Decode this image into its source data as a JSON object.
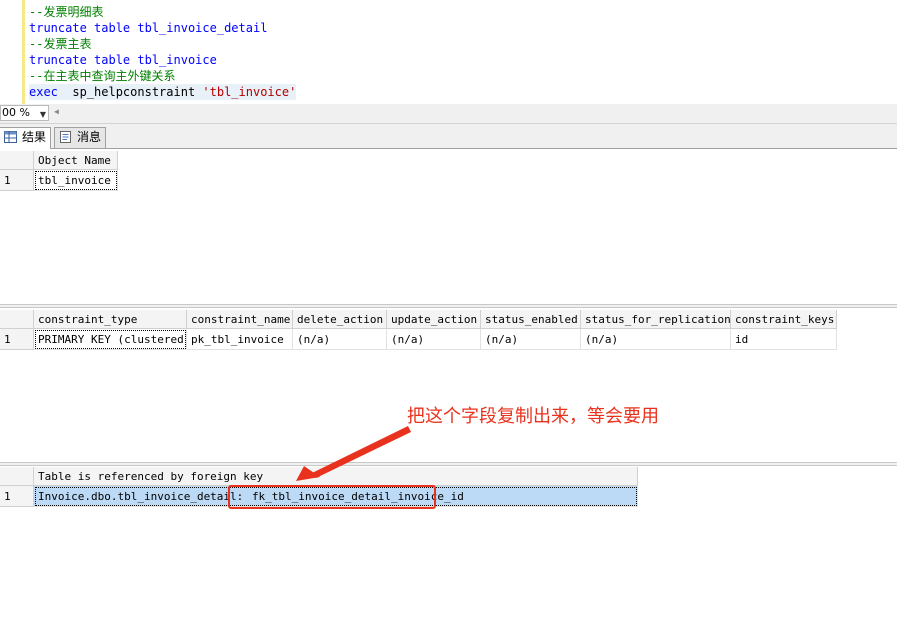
{
  "editor": {
    "lines": [
      {
        "parts": [
          {
            "cls": "c-comment",
            "text": "--发票明细表"
          }
        ]
      },
      {
        "parts": [
          {
            "cls": "c-kw",
            "text": "truncate table "
          },
          {
            "cls": "",
            "text": ""
          },
          {
            "cls": "c-kw",
            "text": "tbl_invoice_detail"
          }
        ]
      },
      {
        "parts": [
          {
            "cls": "c-comment",
            "text": "--发票主表"
          }
        ]
      },
      {
        "parts": [
          {
            "cls": "c-kw",
            "text": "truncate table "
          },
          {
            "cls": "c-kw",
            "text": "tbl_invoice"
          }
        ]
      },
      {
        "parts": [
          {
            "cls": "c-comment",
            "text": "--在主表中查询主外键关系"
          }
        ]
      },
      {
        "parts": [
          {
            "cls": "c-kw",
            "text": "exec"
          },
          {
            "cls": "",
            "text": "  sp_helpconstraint "
          },
          {
            "cls": "c-str",
            "text": "'tbl_invoice'"
          }
        ]
      }
    ]
  },
  "zoom": {
    "value": "00 %"
  },
  "tabs": [
    {
      "label": "结果",
      "active": true
    },
    {
      "label": "消息",
      "active": false
    }
  ],
  "grid1": {
    "columns": [
      "Object Name"
    ],
    "rows": [
      {
        "num": "1",
        "cells": [
          "tbl_invoice"
        ]
      }
    ]
  },
  "grid2": {
    "columns": [
      "constraint_type",
      "constraint_name",
      "delete_action",
      "update_action",
      "status_enabled",
      "status_for_replication",
      "constraint_keys"
    ],
    "rows": [
      {
        "num": "1",
        "cells": [
          "PRIMARY KEY (clustered)",
          "pk_tbl_invoice",
          "(n/a)",
          "(n/a)",
          "(n/a)",
          "(n/a)",
          "id"
        ]
      }
    ]
  },
  "grid3": {
    "columns": [
      "Table is referenced by foreign key"
    ],
    "rows": [
      {
        "num": "1",
        "cells": [
          "Invoice.dbo.tbl_invoice_detail: fk_tbl_invoice_detail_invoice_id"
        ]
      }
    ],
    "cell_prefix": "Invoice.dbo.tbl_invoice_detail:",
    "cell_highlight": "fk_tbl_invoice_detail_invoice_id"
  },
  "annotation": {
    "text": "把这个字段复制出来，等会要用",
    "color": "#e8321e"
  },
  "colors": {
    "comment": "#008000",
    "keyword": "#0000ff",
    "string": "#b40000",
    "selection": "#bcd9f5"
  }
}
